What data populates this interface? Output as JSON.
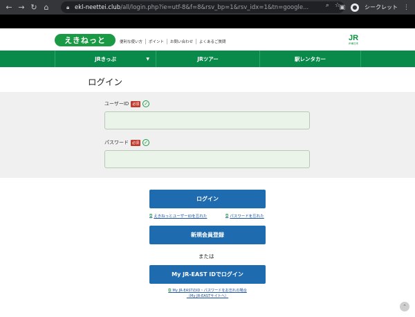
{
  "browser": {
    "url_host": "ekl-neettei.club",
    "url_path": "/all/login.php?ie=utf-8&f=8&rsv_bp=1&rsv_idx=1&tn=google...",
    "incognito_label": "シークレット",
    "icons": [
      "back-icon",
      "forward-icon",
      "reload-icon",
      "home-icon",
      "lock-icon",
      "zoom-icon",
      "star-icon",
      "sidepanel-icon",
      "incognito-icon",
      "menu-icon"
    ]
  },
  "header": {
    "logo_text": "えきねっと",
    "util_links": [
      "便利な使い方",
      "ポイント",
      "お問い合わせ",
      "よくあるご質問"
    ],
    "jr_mark": "JR",
    "jr_sub": "JR東日本"
  },
  "nav": {
    "items": [
      {
        "label": "JRきっぷ"
      },
      {
        "label": "JRツアー"
      },
      {
        "label": "駅レンタカー"
      }
    ]
  },
  "login": {
    "title": "ログイン",
    "userid_label": "ユーザーID",
    "password_label": "パスワード",
    "required_badge": "必須",
    "check_glyph": "✓",
    "login_button": "ログイン",
    "forgot_userid": "えきねっとユーザーIDを忘れた",
    "forgot_password": "パスワードを忘れた",
    "register_button": "新規会員登録",
    "or_text": "または",
    "jreast_button": "My JR-EAST IDでログイン",
    "jreast_forgot_line1": "My JR-EASTのID・パスワードをお忘れの場合",
    "jreast_forgot_line2": "（My JR-EASTサイトへ）"
  },
  "colors": {
    "brand_green": "#0a8a4a",
    "button_blue": "#1e6bb0",
    "input_bg": "#eaf4e9",
    "required_red": "#c0392b"
  }
}
